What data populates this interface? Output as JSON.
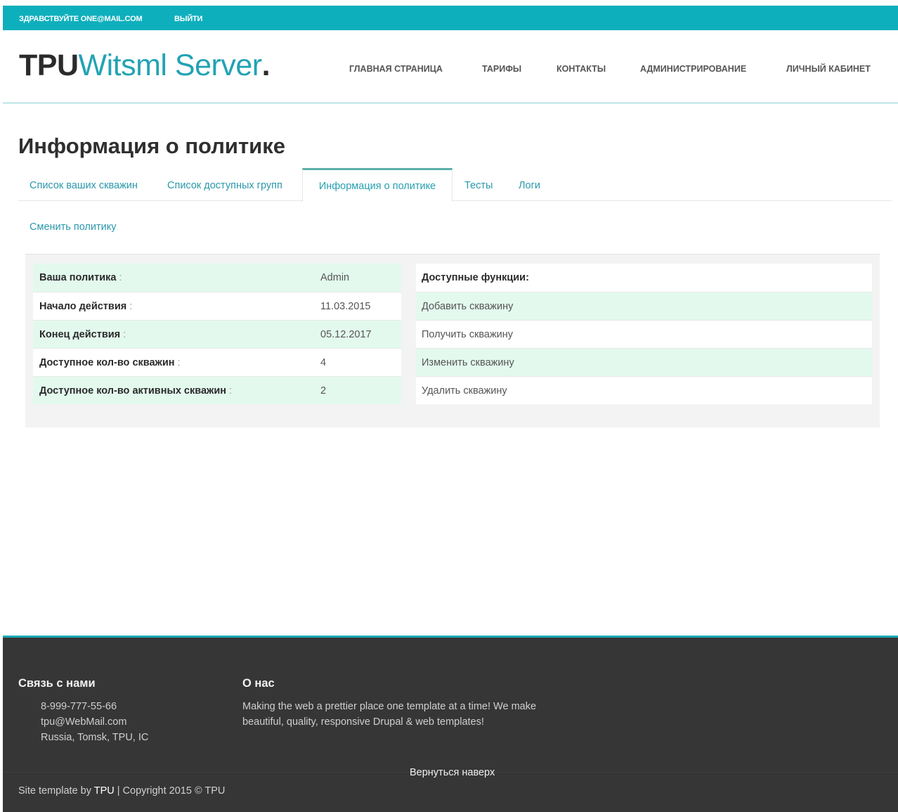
{
  "topbar": {
    "greeting": "ЗДРАВСТВУЙТЕ ONE@MAIL.COM",
    "logout": "ВЫЙТИ"
  },
  "header": {
    "logo_part1": "TPU",
    "logo_part2": "Witsml Server",
    "logo_part3": ".",
    "nav": [
      "ГЛАВНАЯ СТРАНИЦА",
      "ТАРИФЫ",
      "КОНТАКТЫ",
      "АДМИНИСТРИРОВАНИЕ",
      "ЛИЧНЫЙ КАБИНЕТ"
    ]
  },
  "main": {
    "title": "Информация о политике",
    "tabs": [
      "Список ваших скважин",
      "Список доступных групп",
      "Информация о политике",
      "Тесты",
      "Логи"
    ],
    "active_tab": "Информация о политике",
    "change_policy": "Сменить политику",
    "policy_rows": [
      {
        "label": "Ваша политика",
        "colon": ":",
        "value": "Admin"
      },
      {
        "label": "Начало действия",
        "colon": ":",
        "value": "11.03.2015"
      },
      {
        "label": "Конец действия",
        "colon": ":",
        "value": "05.12.2017"
      },
      {
        "label": "Доступное кол-во скважин",
        "colon": ":",
        "value": "4"
      },
      {
        "label": "Доступное кол-во активных скважин",
        "colon": ":",
        "value": "2"
      }
    ],
    "functions_header": "Доступные функции:",
    "functions": [
      "Добавить скважину",
      "Получить скважину",
      "Изменить скважину",
      "Удалить скважину"
    ]
  },
  "footer": {
    "contact_title": "Связь с нами",
    "contacts": [
      "8-999-777-55-66",
      "tpu@WebMail.com",
      "Russia, Tomsk, TPU, IC"
    ],
    "about_title": "О нас",
    "about_text": "Making the web a prettier place one template at a time! We make beautiful, quality, responsive Drupal & web templates!",
    "back_to_top": "Вернуться наверх",
    "copyright_prefix": "Site template by ",
    "copyright_brand": "TPU",
    "copyright_suffix": " | Copyright 2015 © TPU"
  },
  "colors": {
    "accent": "#0eafbd",
    "link": "#2a98ab",
    "row_highlight": "#e3f9ee",
    "footer_bg": "#363636"
  }
}
